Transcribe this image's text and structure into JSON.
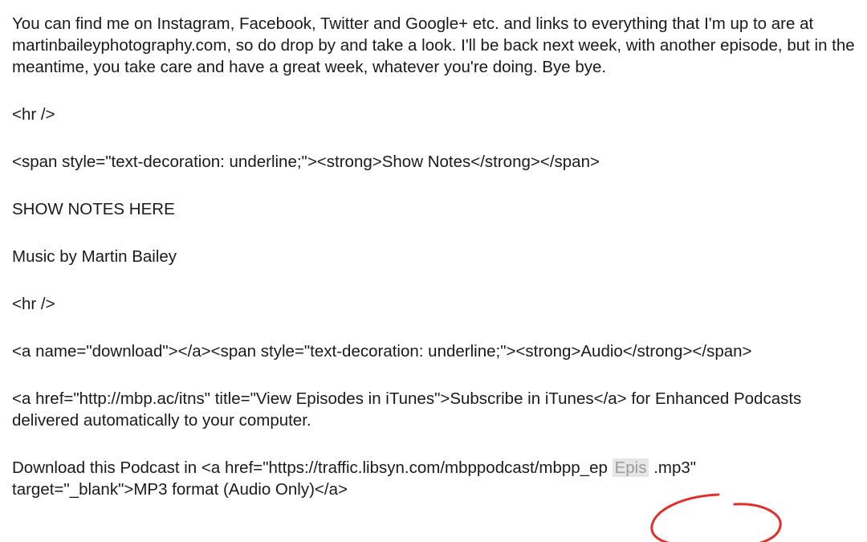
{
  "editor": {
    "paragraphs": [
      "You can find me on Instagram, Facebook, Twitter and Google+ etc. and links to everything that I'm up to are at martinbaileyphotography.com, so do drop by and take a look. I'll be back next week, with another episode, but in the meantime, you take care and have a great week, whatever you're doing. Bye bye.",
      "<hr />",
      "<span style=\"text-decoration: underline;\"><strong>Show Notes</strong></span>",
      "SHOW NOTES HERE",
      "Music by Martin Bailey",
      "<hr />",
      "<a name=\"download\"></a><span style=\"text-decoration: underline;\"><strong>Audio</strong></span>",
      "<a href=\"http://mbp.ac/itns\" title=\"View Episodes in iTunes\">Subscribe in iTunes</a> for Enhanced Podcasts delivered automatically to your computer."
    ],
    "download_line": {
      "prefix": "Download this Podcast in <a href=\"https://traffic.libsyn.com/mbppodcast/mbpp_ep",
      "placeholder": "Epis",
      "suffix": ".mp3\"",
      "continuation": "target=\"_blank\">MP3 format (Audio Only)</a>"
    }
  },
  "colors": {
    "text": "#1a1a1a",
    "annotation": "#e0302a",
    "placeholder_bg": "#e6e6e6",
    "placeholder_text": "#9a9a9a"
  }
}
